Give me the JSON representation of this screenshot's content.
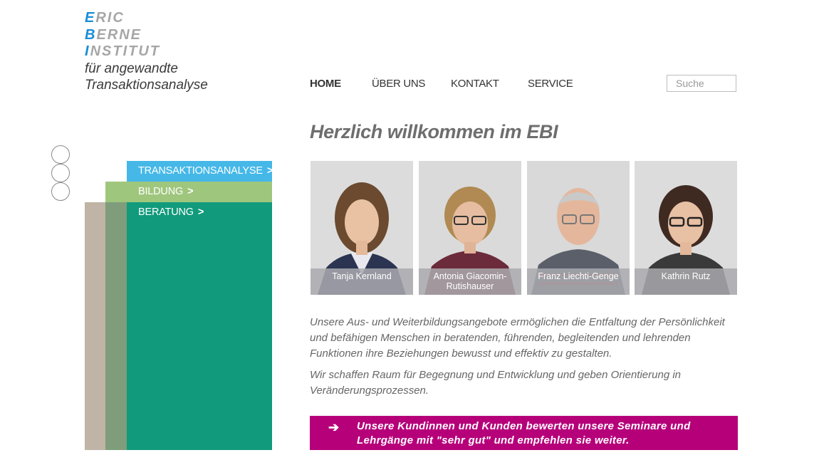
{
  "logo": {
    "line1_initial": "E",
    "line1_rest": "RIC",
    "line2_initial": "B",
    "line2_rest": "ERNE",
    "line3_initial": "I",
    "line3_rest": "NSTITUT",
    "line4": "für angewandte",
    "line5": "Transaktionsanalyse"
  },
  "nav": {
    "items": [
      {
        "label": "HOME"
      },
      {
        "label": "ÜBER UNS"
      },
      {
        "label": "KONTAKT"
      },
      {
        "label": "SERVICE"
      }
    ],
    "search_placeholder": "Suche"
  },
  "side_menu": {
    "items": [
      {
        "label": "TRANSAKTIONSANALYSE",
        "chevron": ">"
      },
      {
        "label": "BILDUNG",
        "chevron": ">"
      },
      {
        "label": "BERATUNG",
        "chevron": ">"
      }
    ]
  },
  "main": {
    "headline": "Herzlich willkommen im EBI",
    "team": [
      {
        "name": "Tanja Kernland"
      },
      {
        "name_line1": "Antonia Giacomin-",
        "name_line2": "Rutishauser"
      },
      {
        "name": "Franz Liechti-Genge"
      },
      {
        "name": "Kathrin Rutz"
      }
    ],
    "paragraph1": "Unsere Aus- und Weiterbildungsangebote ermöglichen die Entfaltung der Persönlichkeit und befähigen Menschen in beratenden, führenden, begleitenden und lehrenden Funktionen ihre Beziehungen bewusst und effektiv zu gestalten.",
    "paragraph2": "Wir schaffen Raum für Begegnung und Entwicklung und geben Orientierung in Veränderungsprozessen.",
    "banner": {
      "arrow": "➔",
      "text": "Unsere Kundinnen und Kunden bewerten unsere Seminare und Lehrgänge mit \"sehr gut\" und empfehlen sie weiter."
    }
  },
  "colors": {
    "logo_accent": "#1a8dd6",
    "side_blue": "#45b8e8",
    "side_light_green": "#9fc67d",
    "side_teal": "#119a7b",
    "side_olive": "#7f9d7b",
    "side_beige": "#bfb4a5",
    "banner": "#b6007a"
  }
}
